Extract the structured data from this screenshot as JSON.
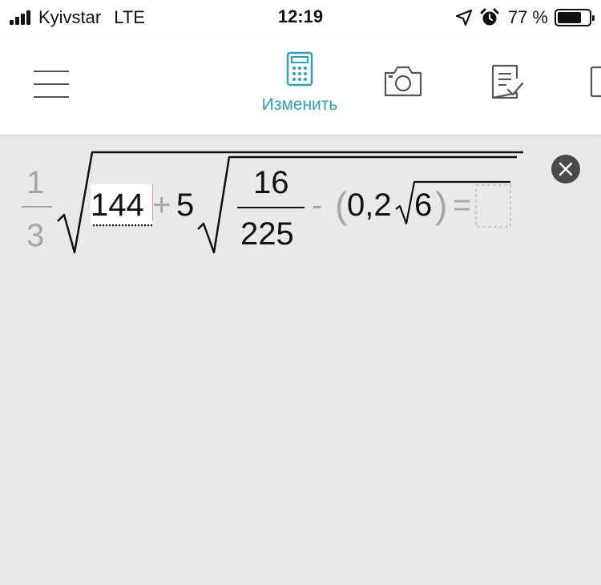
{
  "status_bar": {
    "carrier": "Kyivstar",
    "network": "LTE",
    "time": "12:19",
    "battery_percent": "77 %",
    "battery_level": 0.77
  },
  "toolbar": {
    "active_tab_label": "Изменить",
    "accent_color": "#2aa3b5",
    "icons": [
      "menu-icon",
      "calculator-icon",
      "camera-icon",
      "notes-check-icon",
      "more-icon"
    ]
  },
  "formula": {
    "coef_numerator": "1",
    "coef_denominator": "3",
    "term1": "144",
    "plus": "+",
    "coef2": "5",
    "frac_numerator": "16",
    "frac_denominator": "225",
    "minus": "-",
    "paren_open": "(",
    "decimal": "0,2",
    "root_arg": "6",
    "paren_close": ")",
    "equals": "="
  }
}
